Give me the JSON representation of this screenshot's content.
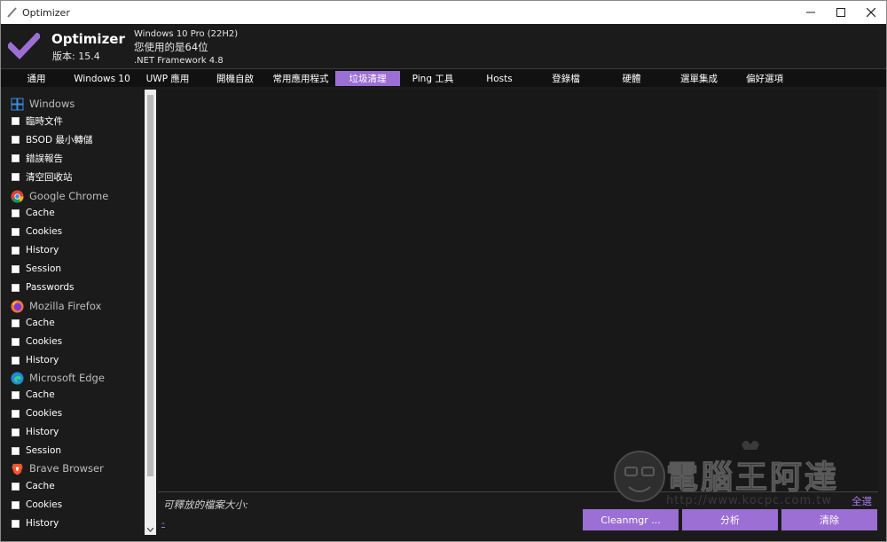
{
  "window": {
    "title": "Optimizer"
  },
  "header": {
    "app_name": "Optimizer",
    "version": "版本: 15.4",
    "os": "Windows 10 Pro (22H2)",
    "arch": "您使用的是64位",
    "framework": ".NET Framework 4.8"
  },
  "tabs": [
    {
      "label": "通用"
    },
    {
      "label": "Windows 10"
    },
    {
      "label": "UWP 應用"
    },
    {
      "label": "開機自啟"
    },
    {
      "label": "常用應用程式"
    },
    {
      "label": "垃圾清理"
    },
    {
      "label": "Ping 工具"
    },
    {
      "label": "Hosts"
    },
    {
      "label": "登錄檔"
    },
    {
      "label": "硬體"
    },
    {
      "label": "選單集成"
    },
    {
      "label": "偏好選項"
    }
  ],
  "active_tab": "垃圾清理",
  "sidebar": {
    "windows": {
      "title": "Windows",
      "icon": "windows-icon",
      "items": [
        "臨時文件",
        "BSOD 最小轉儲",
        "錯誤報告",
        "清空回收站"
      ]
    },
    "chrome": {
      "title": "Google Chrome",
      "icon": "chrome-icon",
      "items": [
        "Cache",
        "Cookies",
        "History",
        "Session",
        "Passwords"
      ]
    },
    "firefox": {
      "title": "Mozilla Firefox",
      "icon": "firefox-icon",
      "items": [
        "Cache",
        "Cookies",
        "History"
      ]
    },
    "edge": {
      "title": "Microsoft Edge",
      "icon": "edge-icon",
      "items": [
        "Cache",
        "Cookies",
        "History",
        "Session"
      ]
    },
    "brave": {
      "title": "Brave Browser",
      "icon": "brave-icon",
      "items": [
        "Cache",
        "Cookies",
        "History"
      ]
    }
  },
  "footer": {
    "freed_label": "可釋放的檔案大小:",
    "freed_value": "-",
    "select_all": "全選",
    "cleanmgr_button": "Cleanmgr ...",
    "analyze_button": "分析",
    "clean_button": "清除"
  },
  "watermark": {
    "title": "電腦王阿達",
    "url": "http://www.kocpc.com.tw"
  },
  "colors": {
    "accent": "#9b6fd4",
    "background": "#1b1b1b",
    "tabbar": "#111111"
  }
}
